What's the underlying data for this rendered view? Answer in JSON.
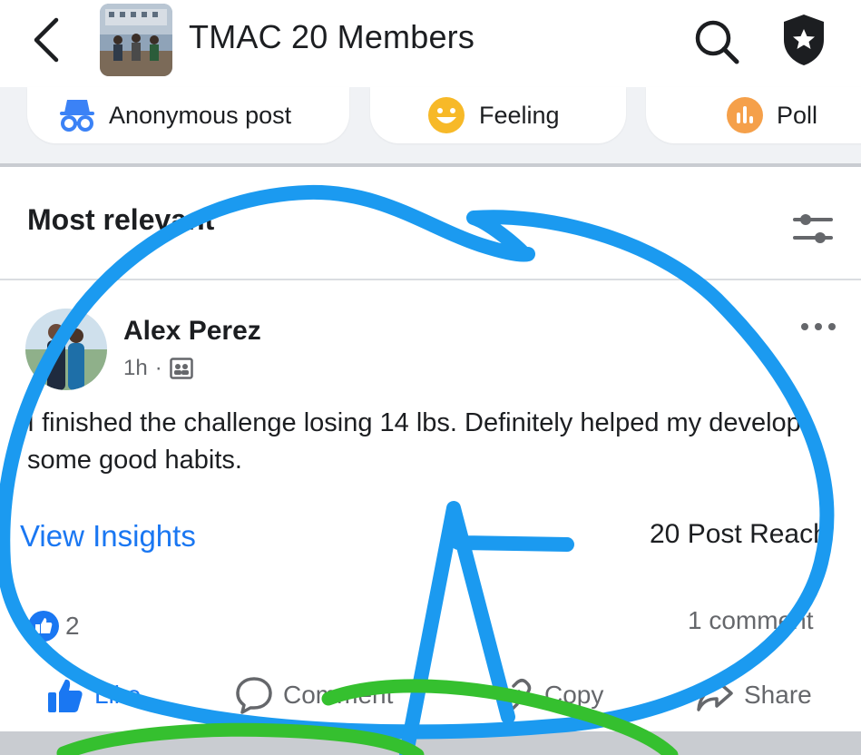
{
  "header": {
    "title": "TMAC 20 Members"
  },
  "composer_actions": [
    {
      "label": "Anonymous post",
      "icon": "incognito-icon"
    },
    {
      "label": "Feeling",
      "icon": "smiley-icon"
    },
    {
      "label": "Poll",
      "icon": "poll-icon"
    }
  ],
  "feed": {
    "sort_label": "Most relevant"
  },
  "post": {
    "author": "Alex Perez",
    "time": "1h",
    "separator": "·",
    "text": "I finished the challenge losing 14 lbs. Definitely helped my develop some good habits.",
    "insights_label": "View Insights",
    "reach_label": "20 Post Reach",
    "reaction_count": "2",
    "comment_count": "1 comment",
    "actions": {
      "like": "Like",
      "comment": "Comment",
      "copy": "Copy",
      "share": "Share"
    }
  },
  "colors": {
    "accent": "#1a77f2",
    "annotation_blue": "#1b9af0",
    "annotation_green": "#35c02f"
  }
}
